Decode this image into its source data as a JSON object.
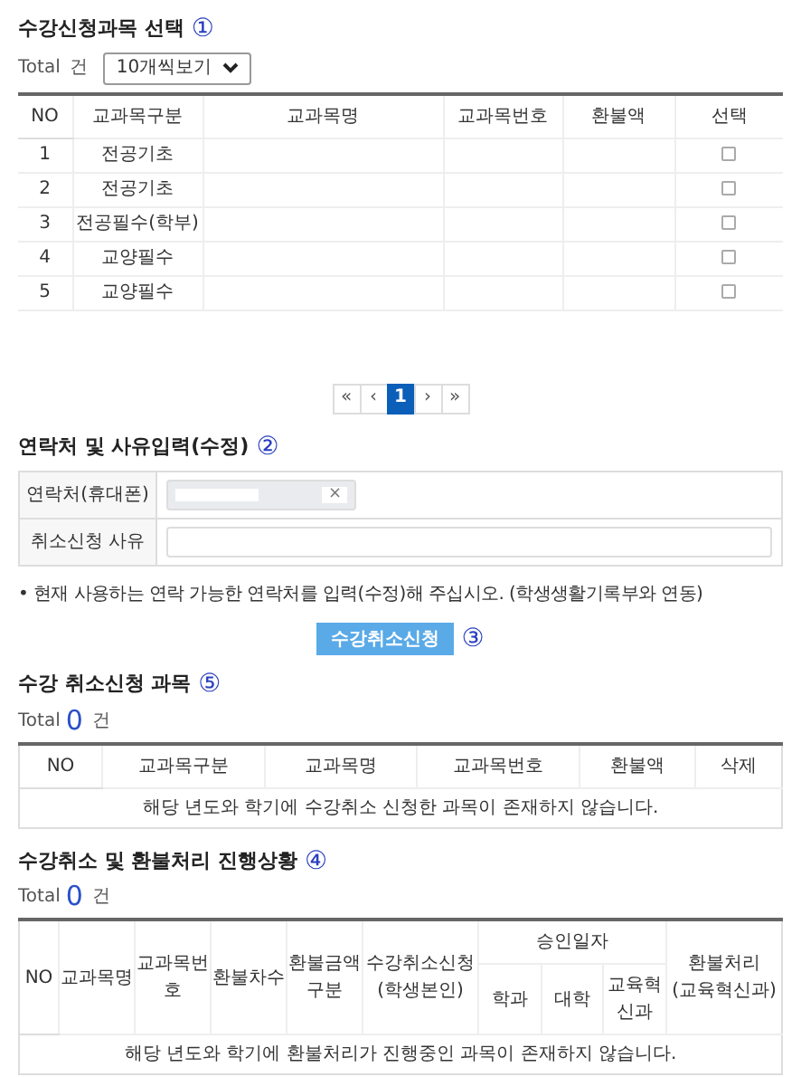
{
  "section_select": {
    "title": "수강신청과목 선택",
    "marker": "①",
    "total_label": "Total",
    "count_unit": "건",
    "page_size": "10개씩보기",
    "columns": [
      "NO",
      "교과목구분",
      "교과목명",
      "교과목번호",
      "환불액",
      "선택"
    ],
    "rows": [
      {
        "no": "1",
        "category": "전공기초",
        "checked": false
      },
      {
        "no": "2",
        "category": "전공기초",
        "checked": false
      },
      {
        "no": "3",
        "category": "전공필수(학부)",
        "checked": false
      },
      {
        "no": "4",
        "category": "교양필수",
        "checked": false
      },
      {
        "no": "5",
        "category": "교양필수",
        "checked": false
      }
    ]
  },
  "pagination": [
    {
      "label": "«",
      "selected": false
    },
    {
      "label": "‹",
      "selected": false
    },
    {
      "label": "1",
      "selected": true
    },
    {
      "label": "›",
      "selected": false
    },
    {
      "label": "»",
      "selected": false
    }
  ],
  "section_contact": {
    "title": "연락처 및 사유입력(수정)",
    "marker": "②",
    "fields": [
      {
        "kind": "phone",
        "label": "연락처(휴대폰)",
        "clear": "×"
      },
      {
        "kind": "text",
        "label": "취소신청 사유"
      }
    ],
    "note": "• 현재 사용하는 연락 가능한 연락처를 입력(수정)해 주십시오. (학생생활기록부와 연동)"
  },
  "submit_button": {
    "label": "수강취소신청",
    "marker": "③"
  },
  "section_cancel": {
    "title": "수강 취소신청 과목",
    "marker": "⑤",
    "total_label": "Total",
    "count": "0",
    "count_unit": "건",
    "columns": [
      "NO",
      "교과목구분",
      "교과목명",
      "교과목번호",
      "환불액",
      "삭제"
    ],
    "empty_message": "해당 년도와 학기에 수강취소 신청한 과목이 존재하지 않습니다."
  },
  "section_progress": {
    "title": "수강취소 및 환불처리 진행상황",
    "marker": "④",
    "total_label": "Total",
    "count": "0",
    "count_unit": "건",
    "columns": [
      {
        "label": "NO"
      },
      {
        "label": "교과목명"
      },
      {
        "label": "교과목번호"
      },
      {
        "label": "환불차수"
      },
      {
        "label": "환불금액구분"
      },
      {
        "label": "수강취소신청\n(학생본인)"
      },
      {
        "label": "승인일자",
        "children": [
          {
            "label": "학과"
          },
          {
            "label": "대학"
          },
          {
            "label": "교육혁신과"
          }
        ]
      },
      {
        "label": "환불처리\n(교육혁신과)"
      }
    ],
    "empty_message": "해당 년도와 학기에 환불처리가 진행중인 과목이 존재하지 않습니다."
  }
}
